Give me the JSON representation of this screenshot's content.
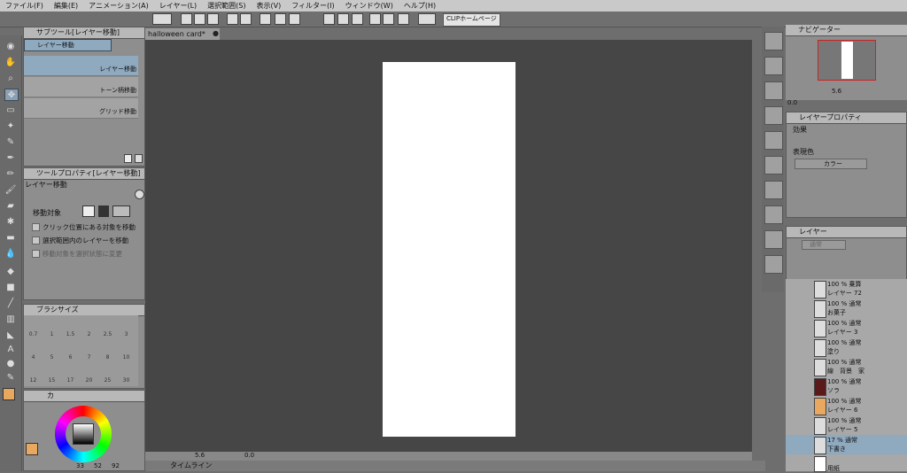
{
  "menu": [
    "ファイル(F)",
    "編集(E)",
    "アニメーション(A)",
    "レイヤー(L)",
    "選択範囲(S)",
    "表示(V)",
    "フィルター(I)",
    "ウィンドウ(W)",
    "ヘルプ(H)"
  ],
  "commandbar": {
    "clip_home_label": "CLIPホームページ"
  },
  "document_tab": {
    "title": "halloween card*"
  },
  "subtool": {
    "tab_label": "サブツール[レイヤー移動]",
    "group_label": "レイヤー移動",
    "items": [
      "レイヤー移動",
      "トーン柄移動",
      "グリッド移動"
    ]
  },
  "tool_property": {
    "tab_label": "ツールプロパティ[レイヤー移動]",
    "tool_name": "レイヤー移動",
    "move_target_label": "移動対象",
    "options": [
      "クリック位置にある対象を移動",
      "選択範囲内のレイヤーを移動",
      "移動対象を選択状態に変更"
    ]
  },
  "brush_size": {
    "tab_label": "ブラシサイズ",
    "sizes": [
      "0.7",
      "1",
      "1.5",
      "2",
      "2.5",
      "3",
      "4",
      "5",
      "6",
      "7",
      "8",
      "10",
      "12",
      "15",
      "17",
      "20",
      "25",
      "30"
    ]
  },
  "color": {
    "tab_label": "カ",
    "main_color": "#e8a860",
    "values": [
      "33",
      "52",
      "92"
    ]
  },
  "navigator": {
    "tab_label": "ナビゲーター",
    "zoom": "5.6",
    "angle": "0.0"
  },
  "layer_property": {
    "tab_label": "レイヤープロパティ",
    "effect_label": "効果",
    "expression_label": "表現色",
    "expression_value": "カラー"
  },
  "layers": {
    "tab_label": "レイヤー",
    "blend_mode": "通常",
    "rows": [
      {
        "mode": "100 % 乗算",
        "name": "レイヤー 72",
        "thumb": "checker"
      },
      {
        "mode": "100 % 通常",
        "name": "お菓子",
        "thumb": "checker"
      },
      {
        "mode": "100 % 通常",
        "name": "レイヤー 3",
        "thumb": "checker"
      },
      {
        "mode": "100 % 通常",
        "name": "塗り",
        "thumb": "checker"
      },
      {
        "mode": "100 % 通常",
        "name": "線　背景　家",
        "thumb": "checker"
      },
      {
        "mode": "100 % 通常",
        "name": "ソラ",
        "thumb": "dark"
      },
      {
        "mode": "100 % 通常",
        "name": "レイヤー 6",
        "thumb": "orange"
      },
      {
        "mode": "100 % 通常",
        "name": "レイヤー 5",
        "thumb": "checker"
      },
      {
        "mode": "17 % 通常",
        "name": "下書き",
        "thumb": "checker"
      },
      {
        "mode": "",
        "name": "用紙",
        "thumb": "white"
      }
    ]
  },
  "canvas_status": {
    "zoom": "5.6",
    "angle": "0.0"
  },
  "timeline": {
    "tab_label": "タイムライン"
  }
}
